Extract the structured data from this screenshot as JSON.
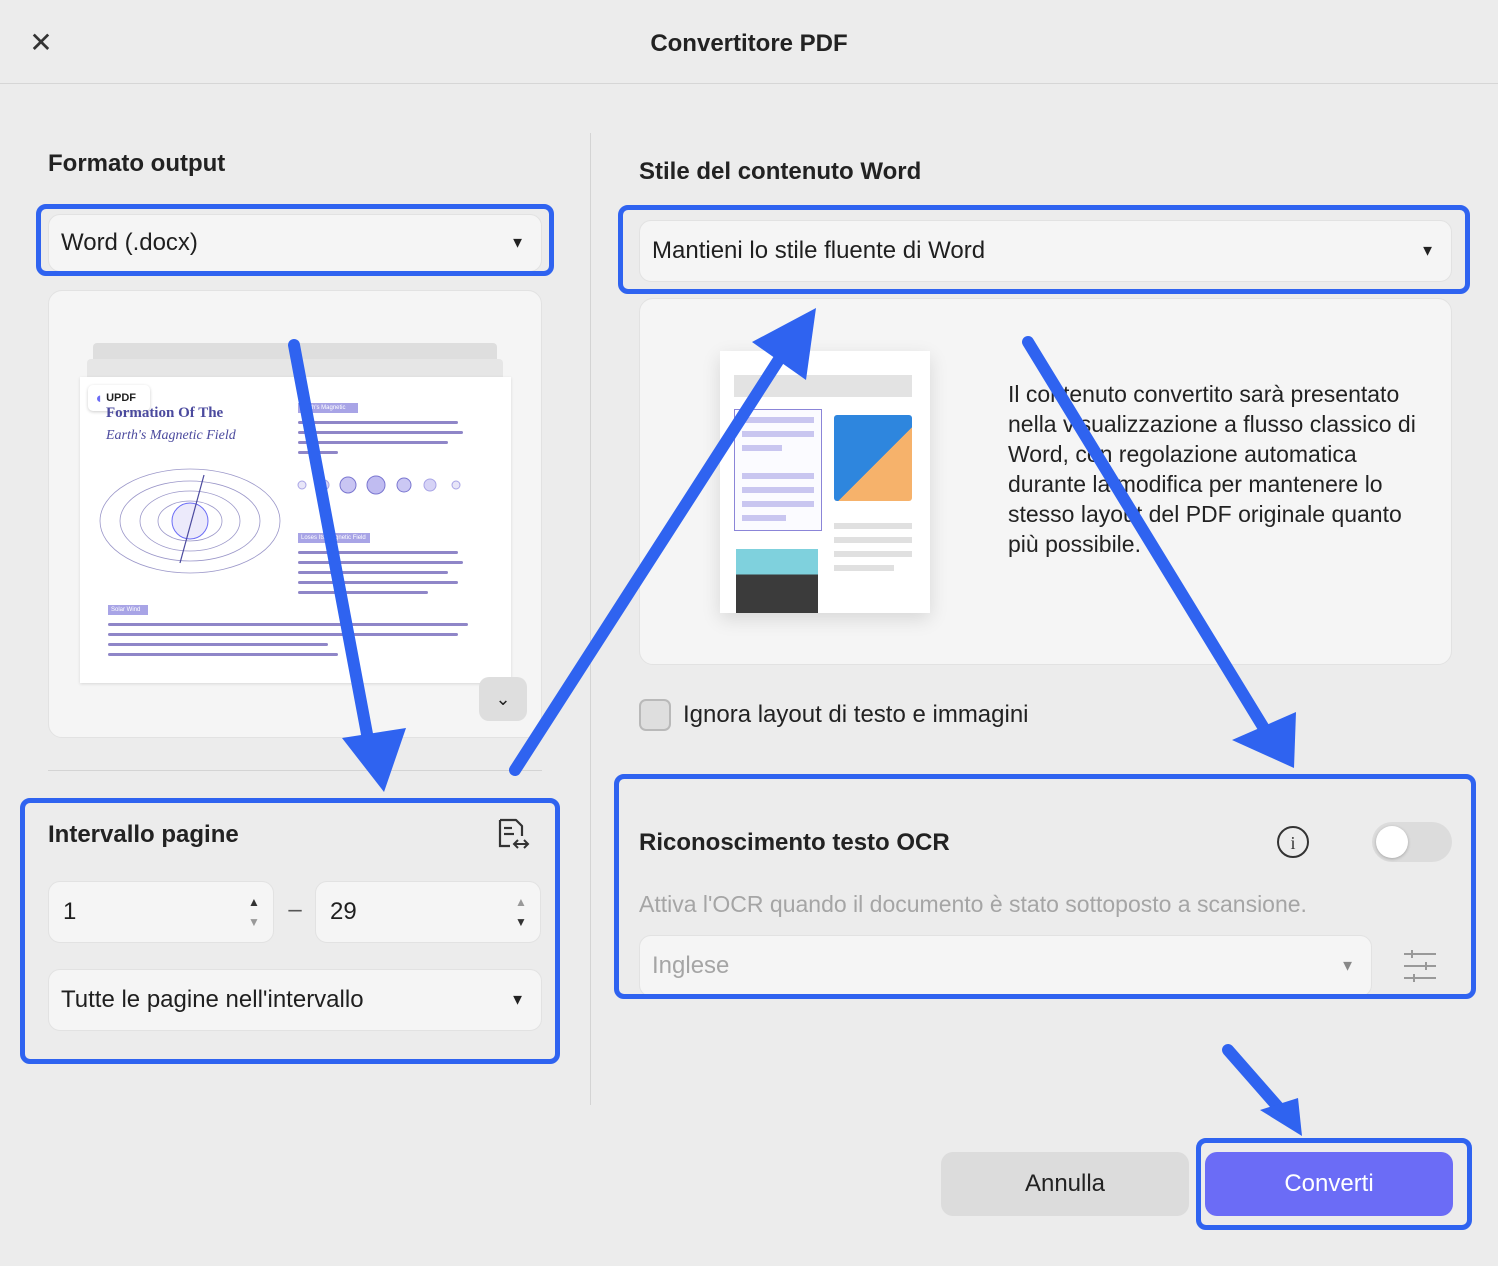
{
  "window": {
    "title": "Convertitore PDF"
  },
  "output_format": {
    "label": "Formato output",
    "value": "Word (.docx)"
  },
  "preview": {
    "logo": "UPDF",
    "doc_title_line1": "Formation Of The",
    "doc_title_line2": "Earth's Magnetic Field",
    "badge1": "Earth's Magnetic",
    "badge2": "Loses Its Magnetic Field",
    "badge3": "Solar Wind"
  },
  "page_range": {
    "label": "Intervallo pagine",
    "from": "1",
    "to": "29",
    "separator": "–",
    "mode": "Tutte le pagine nell'intervallo"
  },
  "word_style": {
    "label": "Stile del contenuto Word",
    "value": "Mantieni lo stile fluente di Word",
    "description": "Il contenuto convertito sarà presentato nella visualizzazione a flusso classico di Word, con regolazione automatica durante la modifica per mantenere lo stesso layout del PDF originale quanto più possibile."
  },
  "ignore_layout": {
    "label": "Ignora layout di testo e immagini",
    "checked": false
  },
  "ocr": {
    "label": "Riconoscimento testo OCR",
    "hint": "Attiva l'OCR quando il documento è stato sottoposto a scansione.",
    "language": "Inglese",
    "enabled": false
  },
  "buttons": {
    "cancel": "Annulla",
    "convert": "Converti"
  },
  "colors": {
    "accent": "#6b6cf6",
    "callout": "#2f63f0",
    "background": "#ececec"
  }
}
